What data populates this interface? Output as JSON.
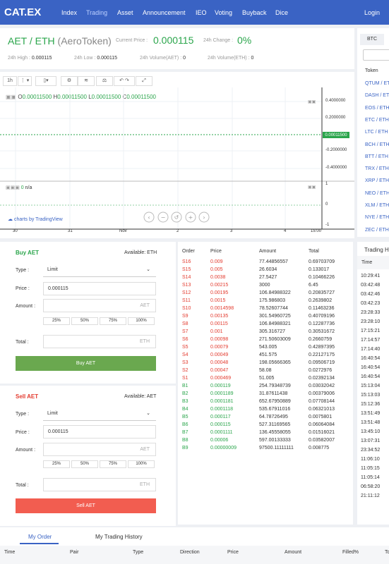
{
  "nav": {
    "logo": "CAT.EX",
    "items": [
      "Index",
      "Trading",
      "Asset",
      "Announcement",
      "IEO",
      "Voting",
      "Buyback",
      "Dice"
    ],
    "login": "Login"
  },
  "ticker": {
    "pair": "AET / ETH",
    "full": "(AeroToken)",
    "current_label": "Current Price :",
    "current": "0.000115",
    "change_label": "24h Change :",
    "change": "0%",
    "stats": [
      {
        "label": "24h High :",
        "value": "0.000115"
      },
      {
        "label": "24h Low :",
        "value": "0.000115"
      },
      {
        "label": "24h Volume(AET) :",
        "value": "0"
      },
      {
        "label": "24h Volume(ETH) :",
        "value": "0"
      }
    ]
  },
  "side": {
    "tab": "BTC",
    "header": "Token",
    "tokens": [
      "QTUM / ETH",
      "DASH / ETH",
      "EOS / ETH",
      "ETC / ETH",
      "LTC / ETH",
      "BCH / ETH",
      "BTT / ETH",
      "TRX / ETH",
      "XRP / ETH",
      "NEO / ETH",
      "XLM / ETH",
      "NYE / ETH",
      "ZEC / ETH"
    ]
  },
  "chart": {
    "toolbar": {
      "interval": "1h"
    },
    "ohlc": {
      "o_label": "O",
      "o": "0.00011500",
      "h_label": "H",
      "h": "0.00011500",
      "l_label": "L",
      "l": "0.00011500",
      "c_label": "C",
      "c": "0.00011500"
    },
    "price_ticks": [
      "0.4000000",
      "0.2000000",
      "-0.2000000",
      "-0.4000000"
    ],
    "last_price": "0.00011500",
    "vol": {
      "value": "0",
      "na": "n/a"
    },
    "vol_ticks": [
      "1",
      "0",
      "-1"
    ],
    "x_ticks": [
      "30",
      "31",
      "Nov",
      "2",
      "3",
      "4",
      "15:00"
    ],
    "credit": "charts by TradingView"
  },
  "buy": {
    "title": "Buy AET",
    "available": "Available: ETH",
    "type_label": "Type :",
    "type": "Limit",
    "price_label": "Price :",
    "price": "0.000115",
    "amount_label": "Amount :",
    "amount_unit": "AET",
    "pcts": [
      "25%",
      "50%",
      "75%",
      "100%"
    ],
    "total_label": "Total :",
    "total_unit": "ETH",
    "button": "Buy AET"
  },
  "sell": {
    "title": "Sell AET",
    "available": "Available: AET",
    "type_label": "Type :",
    "type": "Limit",
    "price_label": "Price :",
    "price": "0.000115",
    "amount_label": "Amount :",
    "amount_unit": "AET",
    "pcts": [
      "25%",
      "50%",
      "75%",
      "100%"
    ],
    "total_label": "Total :",
    "total_unit": "ETH",
    "button": "Sell AET"
  },
  "book": {
    "headers": [
      "Order",
      "Price",
      "Amount",
      "Total"
    ],
    "rows": [
      [
        "S16",
        "0.009",
        "77.44856557",
        "0.69703709"
      ],
      [
        "S15",
        "0.005",
        "26.6034",
        "0.133017"
      ],
      [
        "S14",
        "0.0038",
        "27.5427",
        "0.10466226"
      ],
      [
        "S13",
        "0.00215",
        "3000",
        "6.45"
      ],
      [
        "S12",
        "0.00195",
        "106.84988322",
        "0.20835727"
      ],
      [
        "S11",
        "0.0015",
        "175.986803",
        "0.2639802"
      ],
      [
        "S10",
        "0.0014598",
        "78.52607744",
        "0.11463236"
      ],
      [
        "S9",
        "0.00135",
        "301.54960725",
        "0.40709196"
      ],
      [
        "S8",
        "0.00115",
        "106.84988321",
        "0.12287736"
      ],
      [
        "S7",
        "0.001",
        "305.316727",
        "0.30531672"
      ],
      [
        "S6",
        "0.00098",
        "271.50603009",
        "0.2660759"
      ],
      [
        "S5",
        "0.00079",
        "543.005",
        "0.42897395"
      ],
      [
        "S4",
        "0.00049",
        "451.575",
        "0.22127175"
      ],
      [
        "S3",
        "0.00048",
        "198.05666365",
        "0.09506719"
      ],
      [
        "S2",
        "0.00047",
        "58.08",
        "0.0272976"
      ],
      [
        "S1",
        "0.000469",
        "51.005",
        "0.02392134"
      ],
      [
        "B1",
        "0.000119",
        "254.79348739",
        "0.03032042"
      ],
      [
        "B2",
        "0.0001189",
        "31.87611438",
        "0.00379006"
      ],
      [
        "B3",
        "0.0001181",
        "652.67950889",
        "0.07708144"
      ],
      [
        "B4",
        "0.0001118",
        "535.67911016",
        "0.06321013"
      ],
      [
        "B5",
        "0.000117",
        "64.78726495",
        "0.0075801"
      ],
      [
        "B6",
        "0.000115",
        "527.31169565",
        "0.06064084"
      ],
      [
        "B7",
        "0.0001111",
        "136.45558055",
        "0.01516021"
      ],
      [
        "B8",
        "0.00006",
        "597.00133333",
        "0.03582007"
      ],
      [
        "B9",
        "0.00000009",
        "97500.11111111",
        "0.008775"
      ]
    ]
  },
  "trades": {
    "title": "Trading Hi",
    "header": "Time",
    "times": [
      "10:29:41",
      "03:42:48",
      "03:42:46",
      "03:42:23",
      "23:28:33",
      "23:28:10",
      "17:15:21",
      "17:14:57",
      "17:14:40",
      "16:40:54",
      "16:40:54",
      "16:40:54",
      "15:13:04",
      "15:13:03",
      "15:12:36",
      "13:51:49",
      "13:51:48",
      "13:45:10",
      "13:07:31",
      "23:34:52",
      "11:06:10",
      "11:05:15",
      "11:05:14",
      "06:58:20",
      "21:11:12"
    ]
  },
  "bottom": {
    "tabs": [
      "My Order",
      "My Trading History"
    ],
    "columns": [
      "Time",
      "Pair",
      "Type",
      "Direction",
      "Price",
      "Amount",
      "Filled%",
      "To"
    ]
  },
  "colors": {
    "accent": "#3a63c4",
    "up": "#2aa54b",
    "down": "#e33b2f"
  }
}
